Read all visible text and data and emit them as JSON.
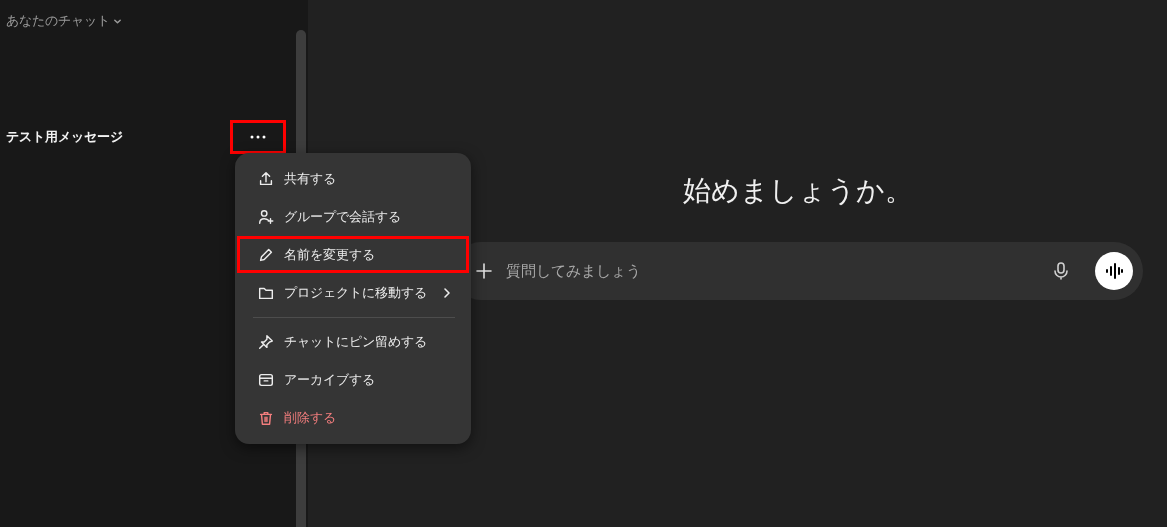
{
  "sidebar": {
    "section": {
      "label": "あなたのチャット",
      "expanded": true
    },
    "chats": [
      {
        "title": "テスト用メッセージ",
        "menu_open": true,
        "annotated": true
      }
    ]
  },
  "context_menu": {
    "items": [
      {
        "label": "共有する",
        "kind": "normal",
        "submenu": false,
        "separator_before": false,
        "annotated": false
      },
      {
        "label": "グループで会話する",
        "kind": "normal",
        "submenu": false,
        "separator_before": false,
        "annotated": false
      },
      {
        "label": "名前を変更する",
        "kind": "normal",
        "submenu": false,
        "separator_before": false,
        "annotated": true
      },
      {
        "label": "プロジェクトに移動する",
        "kind": "normal",
        "submenu": true,
        "separator_before": false,
        "annotated": false
      },
      {
        "label": "チャットにピン留めする",
        "kind": "normal",
        "submenu": false,
        "separator_before": true,
        "annotated": false
      },
      {
        "label": "アーカイブする",
        "kind": "normal",
        "submenu": false,
        "separator_before": false,
        "annotated": false
      },
      {
        "label": "削除する",
        "kind": "danger",
        "submenu": false,
        "separator_before": false,
        "annotated": false
      }
    ]
  },
  "main": {
    "heading": "始めましょうか。",
    "composer": {
      "placeholder": "質問してみましょう"
    }
  }
}
